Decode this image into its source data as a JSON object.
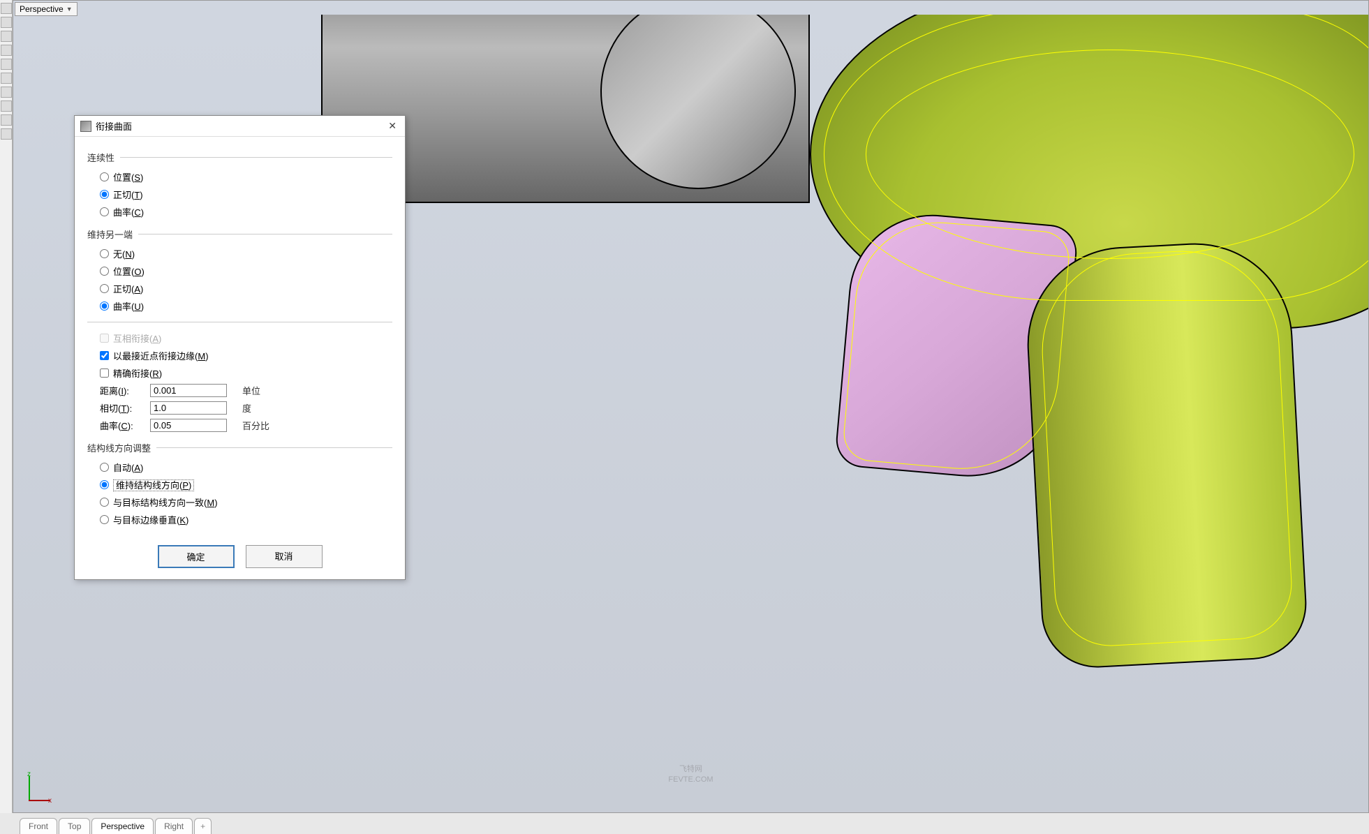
{
  "viewport": {
    "active_view": "Perspective"
  },
  "axis": {
    "z": "z",
    "x": "x"
  },
  "dialog": {
    "title": "衔接曲面",
    "sections": {
      "continuity": {
        "header": "连续性",
        "options": {
          "position": "位置(S)",
          "tangent": "正切(T)",
          "curvature": "曲率(C)"
        },
        "selected": "tangent"
      },
      "preserve": {
        "header": "维持另一端",
        "options": {
          "none": "无(N)",
          "position": "位置(O)",
          "tangent": "正切(A)",
          "curvature": "曲率(U)"
        },
        "selected": "curvature"
      },
      "checks": {
        "mutual": "互相衔接(A)",
        "nearest": "以最接近点衔接边缘(M)",
        "refine": "精确衔接(R)"
      },
      "fields": {
        "distance_label": "距离(I):",
        "distance_value": "0.001",
        "distance_unit": "单位",
        "tangent_label": "相切(T):",
        "tangent_value": "1.0",
        "tangent_unit": "度",
        "curvature_label": "曲率(C):",
        "curvature_value": "0.05",
        "curvature_unit": "百分比"
      },
      "isocurve": {
        "header": "结构线方向调整",
        "options": {
          "auto": "自动(A)",
          "preserve": "维持结构线方向(P)",
          "match_target": "与目标结构线方向一致(M)",
          "perp_target": "与目标边缘垂直(K)"
        },
        "selected": "preserve"
      }
    },
    "buttons": {
      "ok": "确定",
      "cancel": "取消"
    }
  },
  "bottom_tabs": {
    "tabs": [
      "Front",
      "Top",
      "Perspective",
      "Right"
    ],
    "active": "Perspective"
  },
  "watermark": {
    "line1": "飞特网",
    "line2": "FEVTE.COM"
  }
}
